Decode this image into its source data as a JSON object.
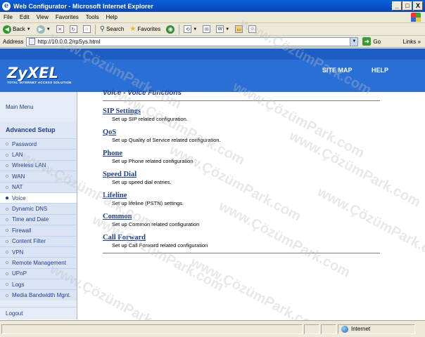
{
  "window": {
    "title": "Web Configurator - Microsoft Internet Explorer",
    "controls": {
      "minimize": "_",
      "maximize": "□",
      "close": "X"
    }
  },
  "menubar": {
    "items": [
      "File",
      "Edit",
      "View",
      "Favorites",
      "Tools",
      "Help"
    ]
  },
  "toolbar": {
    "back_label": "Back",
    "search_label": "Search",
    "favorites_label": "Favorites"
  },
  "address": {
    "label": "Address",
    "url": "http://10.0.0.2/rpSys.html",
    "go_label": "Go",
    "links_label": "Links"
  },
  "header": {
    "logo_text": "ZyXEL",
    "logo_tagline": "TOTAL INTERNET ACCESS SOLUTION",
    "site_map": "SITE MAP",
    "help": "HELP"
  },
  "sidebar": {
    "main_menu": "Main Menu",
    "advanced_setup": "Advanced Setup",
    "items": [
      {
        "label": "Password",
        "active": false
      },
      {
        "label": "LAN",
        "active": false
      },
      {
        "label": "Wireless LAN",
        "active": false
      },
      {
        "label": "WAN",
        "active": false
      },
      {
        "label": "NAT",
        "active": false
      },
      {
        "label": "Voice",
        "active": true
      },
      {
        "label": "Dynamic DNS",
        "active": false
      },
      {
        "label": "Time and Date",
        "active": false
      },
      {
        "label": "Firewall",
        "active": false
      },
      {
        "label": "Content Filter",
        "active": false
      },
      {
        "label": "VPN",
        "active": false
      },
      {
        "label": "Remote Management",
        "active": false
      },
      {
        "label": "UPnP",
        "active": false
      },
      {
        "label": "Logs",
        "active": false
      },
      {
        "label": "Media Bandwidth Mgnt.",
        "active": false
      }
    ],
    "logout": "Logout"
  },
  "main": {
    "title": "Voice - Voice Functions",
    "functions": [
      {
        "name": "SIP Settings",
        "desc": "Set up SIP related configuration."
      },
      {
        "name": "QoS",
        "desc": "Set up Quality of Service related configuration."
      },
      {
        "name": "Phone",
        "desc": "Set up Phone related configuration"
      },
      {
        "name": "Speed Dial",
        "desc": "Set up speed dial entries."
      },
      {
        "name": "Lifeline",
        "desc": "Set up lifeline (PSTN) settings."
      },
      {
        "name": "Common",
        "desc": "Set up Common related configuration"
      },
      {
        "name": "Call Forward",
        "desc": "Set up Call Forward related configuration"
      }
    ]
  },
  "watermark": "www.ÇözümPark.com",
  "status": {
    "zone": "Internet"
  }
}
